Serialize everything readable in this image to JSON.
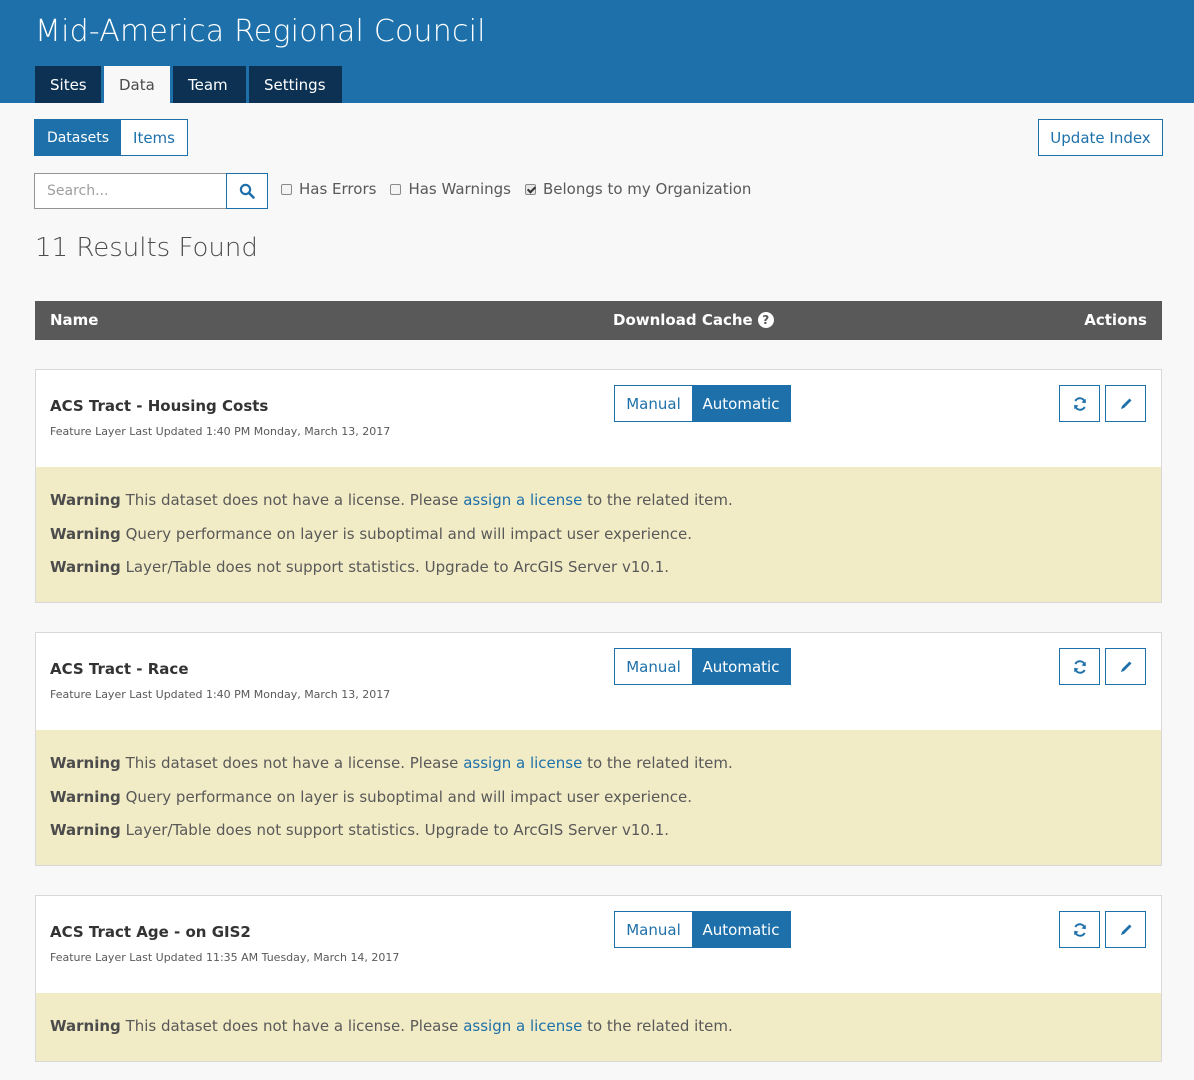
{
  "header": {
    "title": "Mid-America Regional Council",
    "tabs": [
      {
        "label": "Sites",
        "active": false
      },
      {
        "label": "Data",
        "active": true
      },
      {
        "label": "Team",
        "active": false
      },
      {
        "label": "Settings",
        "active": false
      }
    ]
  },
  "toolbar": {
    "view_toggle": {
      "datasets_label": "Datasets",
      "items_label": "Items",
      "selected": "Datasets"
    },
    "update_index_label": "Update Index"
  },
  "search": {
    "placeholder": "Search...",
    "value": "",
    "button_icon": "search-icon"
  },
  "filters": [
    {
      "label": "Has Errors",
      "checked": false
    },
    {
      "label": "Has Warnings",
      "checked": false
    },
    {
      "label": "Belongs to my Organization",
      "checked": true
    }
  ],
  "results": {
    "text": "11 Results Found"
  },
  "table": {
    "headers": {
      "name": "Name",
      "download_cache": "Download Cache",
      "actions": "Actions"
    }
  },
  "datasets": [
    {
      "name": "ACS Tract - Housing Costs",
      "meta": "Feature Layer Last Updated 1:40 PM Monday, March 13, 2017",
      "cache": {
        "manual_label": "Manual",
        "automatic_label": "Automatic",
        "selected": "Automatic"
      },
      "warnings": [
        {
          "label": "Warning",
          "before": "This dataset does not have a license. Please",
          "link": "assign a license",
          "after": "to the related item."
        },
        {
          "label": "Warning",
          "before": "Query performance on layer is suboptimal and will impact user experience.",
          "link": "",
          "after": ""
        },
        {
          "label": "Warning",
          "before": "Layer/Table does not support statistics. Upgrade to ArcGIS Server v10.1.",
          "link": "",
          "after": ""
        }
      ]
    },
    {
      "name": "ACS Tract - Race",
      "meta": "Feature Layer Last Updated 1:40 PM Monday, March 13, 2017",
      "cache": {
        "manual_label": "Manual",
        "automatic_label": "Automatic",
        "selected": "Automatic"
      },
      "warnings": [
        {
          "label": "Warning",
          "before": "This dataset does not have a license. Please",
          "link": "assign a license",
          "after": "to the related item."
        },
        {
          "label": "Warning",
          "before": "Query performance on layer is suboptimal and will impact user experience.",
          "link": "",
          "after": ""
        },
        {
          "label": "Warning",
          "before": "Layer/Table does not support statistics. Upgrade to ArcGIS Server v10.1.",
          "link": "",
          "after": ""
        }
      ]
    },
    {
      "name": "ACS Tract Age - on GIS2",
      "meta": "Feature Layer Last Updated 11:35 AM Tuesday, March 14, 2017",
      "cache": {
        "manual_label": "Manual",
        "automatic_label": "Automatic",
        "selected": "Automatic"
      },
      "warnings": [
        {
          "label": "Warning",
          "before": "This dataset does not have a license. Please",
          "link": "assign a license",
          "after": "to the related item."
        }
      ]
    }
  ],
  "colors": {
    "brand": "#1e70aa",
    "nav_dark": "#0c3153",
    "warning_bg": "#f2ecc6",
    "table_header": "#595959"
  }
}
